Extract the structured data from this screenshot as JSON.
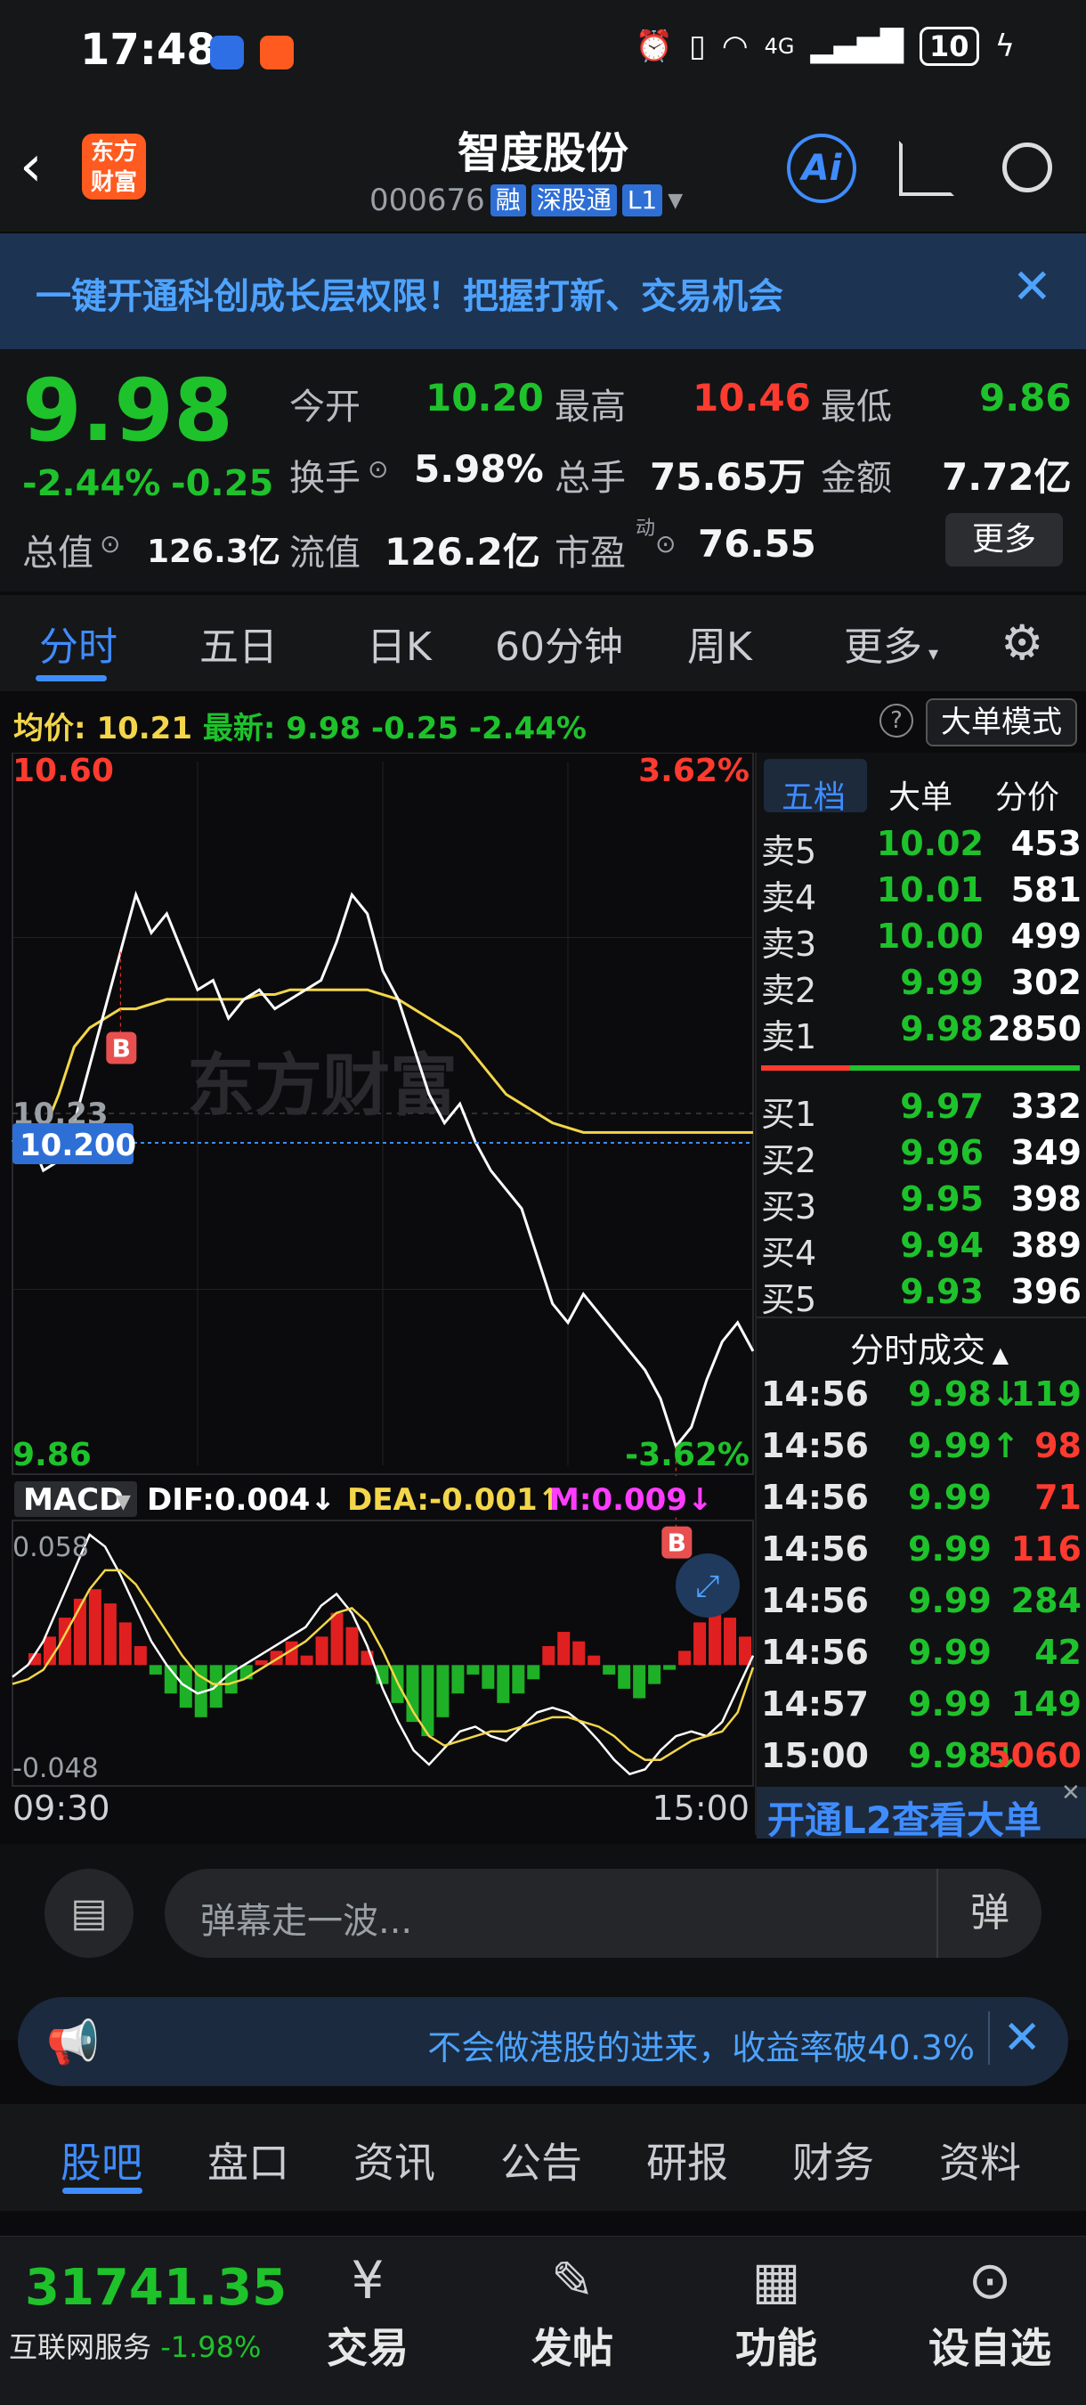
{
  "status_bar": {
    "time": "17:48",
    "network": "4G",
    "battery": "10"
  },
  "header": {
    "logo": "东方财富",
    "stock_name": "智度股份",
    "stock_code": "000676",
    "tags": [
      "融",
      "深股通",
      "L1"
    ]
  },
  "banner": {
    "text": "一键开通科创成长层权限！把握打新、交易机会"
  },
  "quote": {
    "price": "9.98",
    "change_pct": "-2.44%",
    "change": "-0.25",
    "open_label": "今开",
    "open": "10.20",
    "high_label": "最高",
    "high": "10.46",
    "low_label": "最低",
    "low": "9.86",
    "turnover_label": "换手",
    "turnover": "5.98%",
    "volume_label": "总手",
    "volume": "75.65万",
    "amount_label": "金额",
    "amount": "7.72亿",
    "total_mv_label": "总值",
    "total_mv": "126.3亿",
    "float_mv_label": "流值",
    "float_mv": "126.2亿",
    "pe_label": "市盈",
    "pe_sup": "动",
    "pe": "76.55",
    "more": "更多"
  },
  "tabs": [
    "分时",
    "五日",
    "日K",
    "60分钟",
    "周K",
    "更多"
  ],
  "chart_info": {
    "avg_label": "均价:",
    "avg": "10.21",
    "latest_label": "最新:",
    "latest": "9.98",
    "change": "-0.25",
    "change_pct": "-2.44%",
    "big_order_mode": "大单模式"
  },
  "chart_data": {
    "type": "line",
    "y_max_label": "10.60",
    "y_max_pct": "3.62%",
    "y_min_label": "9.86",
    "y_min_pct": "-3.62%",
    "mid_label": "10.23",
    "cursor_label": "10.200",
    "watermark": "东方财富",
    "x_labels": [
      "09:30",
      "15:00"
    ],
    "ylim": [
      9.86,
      10.6
    ],
    "price": [
      10.2,
      10.21,
      10.17,
      10.18,
      10.22,
      10.28,
      10.34,
      10.4,
      10.46,
      10.42,
      10.44,
      10.4,
      10.36,
      10.37,
      10.33,
      10.35,
      10.36,
      10.34,
      10.35,
      10.36,
      10.37,
      10.41,
      10.46,
      10.44,
      10.38,
      10.35,
      10.3,
      10.25,
      10.22,
      10.24,
      10.2,
      10.17,
      10.15,
      10.13,
      10.08,
      10.03,
      10.01,
      10.04,
      10.02,
      10.0,
      9.98,
      9.96,
      9.93,
      9.88,
      9.9,
      9.95,
      9.99,
      10.01,
      9.98
    ],
    "avg": [
      10.2,
      10.21,
      10.21,
      10.25,
      10.3,
      10.32,
      10.33,
      10.34,
      10.34,
      10.345,
      10.35,
      10.35,
      10.35,
      10.35,
      10.35,
      10.35,
      10.355,
      10.355,
      10.36,
      10.36,
      10.36,
      10.36,
      10.36,
      10.36,
      10.355,
      10.35,
      10.34,
      10.33,
      10.32,
      10.31,
      10.29,
      10.27,
      10.25,
      10.24,
      10.23,
      10.22,
      10.215,
      10.21,
      10.21,
      10.21,
      10.21,
      10.21,
      10.21,
      10.21,
      10.21,
      10.21,
      10.21,
      10.21,
      10.21
    ],
    "markers": [
      {
        "label": "B",
        "index": 7
      },
      {
        "label": "B",
        "index": 43
      }
    ],
    "macd": {
      "label": "MACD",
      "dif_label": "DIF:",
      "dif": "0.004",
      "dif_arrow": "↓",
      "dea_label": "DEA:",
      "dea": "-0.001",
      "dea_arrow": "↑",
      "m_label": "M:",
      "m": "0.009",
      "m_arrow": "↓",
      "y_max": "0.058",
      "y_min": "-0.048",
      "ylim": [
        -0.048,
        0.058
      ],
      "hist": [
        0.0,
        0.005,
        0.012,
        0.02,
        0.028,
        0.032,
        0.026,
        0.018,
        0.008,
        -0.004,
        -0.012,
        -0.018,
        -0.022,
        -0.018,
        -0.012,
        -0.006,
        0.002,
        0.006,
        0.01,
        0.004,
        0.012,
        0.022,
        0.016,
        0.006,
        -0.008,
        -0.016,
        -0.024,
        -0.03,
        -0.022,
        -0.012,
        -0.004,
        -0.01,
        -0.016,
        -0.012,
        -0.006,
        0.008,
        0.014,
        0.01,
        0.004,
        -0.004,
        -0.01,
        -0.014,
        -0.008,
        -0.002,
        0.006,
        0.018,
        0.026,
        0.02,
        0.012
      ],
      "dif_line": [
        -0.005,
        0.0,
        0.01,
        0.025,
        0.04,
        0.055,
        0.05,
        0.038,
        0.024,
        0.01,
        0.0,
        -0.008,
        -0.012,
        -0.01,
        -0.004,
        0.0,
        0.004,
        0.008,
        0.012,
        0.016,
        0.025,
        0.03,
        0.022,
        0.008,
        -0.01,
        -0.024,
        -0.036,
        -0.042,
        -0.035,
        -0.028,
        -0.026,
        -0.03,
        -0.032,
        -0.026,
        -0.02,
        -0.018,
        -0.02,
        -0.025,
        -0.032,
        -0.04,
        -0.046,
        -0.044,
        -0.036,
        -0.03,
        -0.028,
        -0.03,
        -0.024,
        -0.01,
        0.004
      ],
      "dea_line": [
        -0.008,
        -0.006,
        -0.002,
        0.008,
        0.02,
        0.032,
        0.04,
        0.04,
        0.034,
        0.024,
        0.014,
        0.004,
        -0.004,
        -0.008,
        -0.008,
        -0.006,
        -0.002,
        0.002,
        0.006,
        0.01,
        0.016,
        0.022,
        0.024,
        0.018,
        0.006,
        -0.008,
        -0.02,
        -0.03,
        -0.034,
        -0.032,
        -0.03,
        -0.028,
        -0.028,
        -0.026,
        -0.024,
        -0.022,
        -0.022,
        -0.024,
        -0.026,
        -0.03,
        -0.036,
        -0.04,
        -0.04,
        -0.036,
        -0.032,
        -0.03,
        -0.028,
        -0.02,
        -0.001
      ]
    }
  },
  "order_book": {
    "tabs": [
      "五档",
      "大单",
      "分价"
    ],
    "asks": [
      {
        "label": "卖5",
        "price": "10.02",
        "vol": "453"
      },
      {
        "label": "卖4",
        "price": "10.01",
        "vol": "581"
      },
      {
        "label": "卖3",
        "price": "10.00",
        "vol": "499"
      },
      {
        "label": "卖2",
        "price": "9.99",
        "vol": "302"
      },
      {
        "label": "卖1",
        "price": "9.98",
        "vol": "2850"
      }
    ],
    "bids": [
      {
        "label": "买1",
        "price": "9.97",
        "vol": "332"
      },
      {
        "label": "买2",
        "price": "9.96",
        "vol": "349"
      },
      {
        "label": "买3",
        "price": "9.95",
        "vol": "398"
      },
      {
        "label": "买4",
        "price": "9.94",
        "vol": "389"
      },
      {
        "label": "买5",
        "price": "9.93",
        "vol": "396"
      }
    ],
    "trades_title": "分时成交",
    "trades": [
      {
        "time": "14:56",
        "price": "9.98↓",
        "vol": "119",
        "color": "#1ec22b"
      },
      {
        "time": "14:56",
        "price": "9.99↑",
        "vol": "98",
        "color": "#ff3b30"
      },
      {
        "time": "14:56",
        "price": "9.99",
        "vol": "71",
        "color": "#ff3b30"
      },
      {
        "time": "14:56",
        "price": "9.99",
        "vol": "116",
        "color": "#ff3b30"
      },
      {
        "time": "14:56",
        "price": "9.99",
        "vol": "284",
        "color": "#1ec22b"
      },
      {
        "time": "14:56",
        "price": "9.99",
        "vol": "42",
        "color": "#1ec22b"
      },
      {
        "time": "14:57",
        "price": "9.99",
        "vol": "149",
        "color": "#1ec22b"
      },
      {
        "time": "15:00",
        "price": "9.98↓",
        "vol": "5060",
        "color": "#ff3b30"
      }
    ],
    "l2_cta": "开通L2查看大单"
  },
  "comment": {
    "placeholder": "弹幕走一波...",
    "danmu": "弹",
    "ad_text": "不会做港股的进来，收益率破40.3%"
  },
  "section_tabs": [
    "股吧",
    "盘口",
    "资讯",
    "公告",
    "研报",
    "财务",
    "资料"
  ],
  "bottom_nav": {
    "index_value": "31741.35",
    "index_name": "互联网服务",
    "index_change": "-1.98%",
    "items": [
      {
        "label": "交易",
        "icon": "yen-icon"
      },
      {
        "label": "发帖",
        "icon": "edit-icon"
      },
      {
        "label": "功能",
        "icon": "grid-icon"
      },
      {
        "label": "设自选",
        "icon": "more-icon"
      }
    ]
  },
  "colors": {
    "up": "#ff3b30",
    "down": "#1ec22b",
    "accent": "#3f8cff",
    "avg_line": "#f3d64a"
  }
}
